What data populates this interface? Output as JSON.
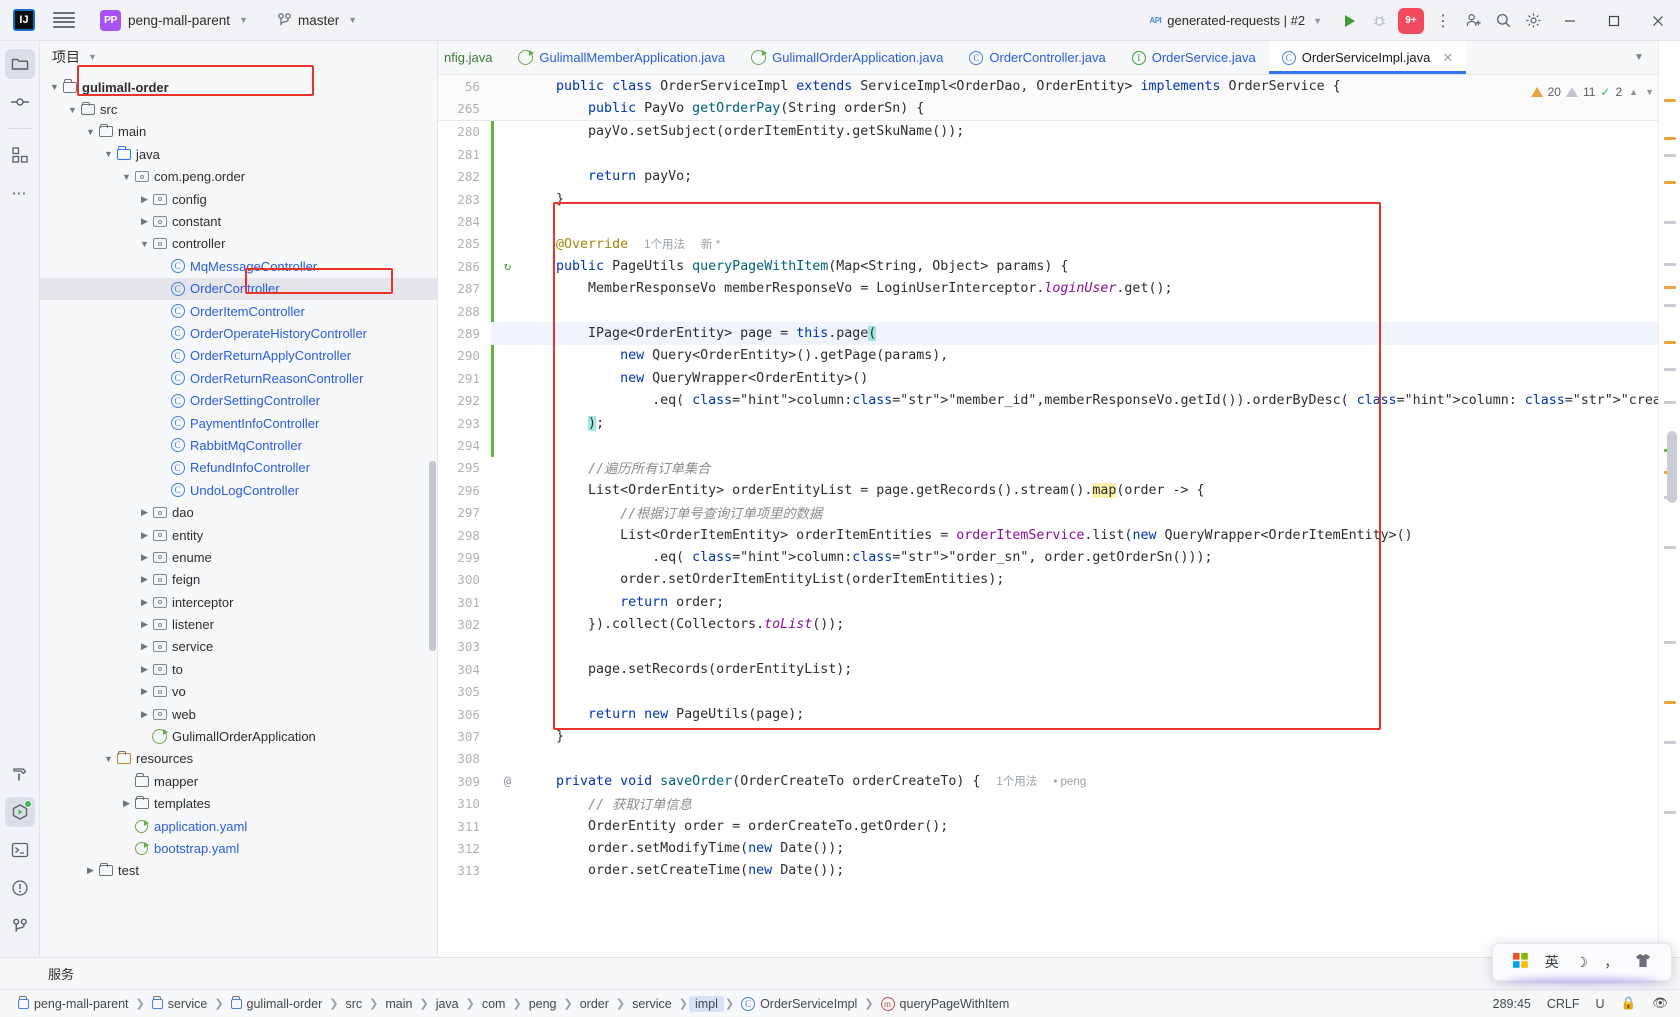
{
  "titlebar": {
    "logo": "IJ",
    "project": "peng-mall-parent",
    "branch": "master",
    "run_config": "generated-requests | #2",
    "notification_count": "9+",
    "minimize": "–",
    "maximize": "☐",
    "close": "✕",
    "more": "⋮"
  },
  "project_panel": {
    "title": "项目",
    "tree": [
      {
        "label": "gulimall-order",
        "depth": 1,
        "arrow": "v",
        "icon": "module-folder-icon",
        "bold": true,
        "boxed": true
      },
      {
        "label": "src",
        "depth": 2,
        "arrow": "v",
        "icon": "folder-icon"
      },
      {
        "label": "main",
        "depth": 3,
        "arrow": "v",
        "icon": "folder-icon"
      },
      {
        "label": "java",
        "depth": 4,
        "arrow": "v",
        "icon": "source-folder-icon"
      },
      {
        "label": "com.peng.order",
        "depth": 5,
        "arrow": "v",
        "icon": "package-icon"
      },
      {
        "label": "config",
        "depth": 6,
        "arrow": ">",
        "icon": "package-icon"
      },
      {
        "label": "constant",
        "depth": 6,
        "arrow": ">",
        "icon": "package-icon"
      },
      {
        "label": "controller",
        "depth": 6,
        "arrow": "v",
        "icon": "package-icon"
      },
      {
        "label": "MqMessageController",
        "depth": 7,
        "arrow": "",
        "icon": "class-icon",
        "cls": true
      },
      {
        "label": "OrderController",
        "depth": 7,
        "arrow": "",
        "icon": "class-icon",
        "cls": true,
        "selected": true,
        "boxed": true
      },
      {
        "label": "OrderItemController",
        "depth": 7,
        "arrow": "",
        "icon": "class-icon",
        "cls": true
      },
      {
        "label": "OrderOperateHistoryController",
        "depth": 7,
        "arrow": "",
        "icon": "class-icon",
        "cls": true
      },
      {
        "label": "OrderReturnApplyController",
        "depth": 7,
        "arrow": "",
        "icon": "class-icon",
        "cls": true
      },
      {
        "label": "OrderReturnReasonController",
        "depth": 7,
        "arrow": "",
        "icon": "class-icon",
        "cls": true
      },
      {
        "label": "OrderSettingController",
        "depth": 7,
        "arrow": "",
        "icon": "class-icon",
        "cls": true
      },
      {
        "label": "PaymentInfoController",
        "depth": 7,
        "arrow": "",
        "icon": "class-icon",
        "cls": true
      },
      {
        "label": "RabbitMqController",
        "depth": 7,
        "arrow": "",
        "icon": "class-icon",
        "cls": true
      },
      {
        "label": "RefundInfoController",
        "depth": 7,
        "arrow": "",
        "icon": "class-icon",
        "cls": true
      },
      {
        "label": "UndoLogController",
        "depth": 7,
        "arrow": "",
        "icon": "class-icon",
        "cls": true
      },
      {
        "label": "dao",
        "depth": 6,
        "arrow": ">",
        "icon": "package-icon"
      },
      {
        "label": "entity",
        "depth": 6,
        "arrow": ">",
        "icon": "package-icon"
      },
      {
        "label": "enume",
        "depth": 6,
        "arrow": ">",
        "icon": "package-icon"
      },
      {
        "label": "feign",
        "depth": 6,
        "arrow": ">",
        "icon": "package-icon"
      },
      {
        "label": "interceptor",
        "depth": 6,
        "arrow": ">",
        "icon": "package-icon"
      },
      {
        "label": "listener",
        "depth": 6,
        "arrow": ">",
        "icon": "package-icon"
      },
      {
        "label": "service",
        "depth": 6,
        "arrow": ">",
        "icon": "package-icon"
      },
      {
        "label": "to",
        "depth": 6,
        "arrow": ">",
        "icon": "package-icon"
      },
      {
        "label": "vo",
        "depth": 6,
        "arrow": ">",
        "icon": "package-icon"
      },
      {
        "label": "web",
        "depth": 6,
        "arrow": ">",
        "icon": "package-icon"
      },
      {
        "label": "GulimallOrderApplication",
        "depth": 6,
        "arrow": "",
        "icon": "spring-boot-icon"
      },
      {
        "label": "resources",
        "depth": 4,
        "arrow": "v",
        "icon": "resource-folder-icon"
      },
      {
        "label": "mapper",
        "depth": 5,
        "arrow": "",
        "icon": "folder-icon"
      },
      {
        "label": "templates",
        "depth": 5,
        "arrow": ">",
        "icon": "folder-icon"
      },
      {
        "label": "application.yaml",
        "depth": 5,
        "arrow": "",
        "icon": "yaml-icon",
        "yaml": true
      },
      {
        "label": "bootstrap.yaml",
        "depth": 5,
        "arrow": "",
        "icon": "yaml-icon",
        "yaml": true
      },
      {
        "label": "test",
        "depth": 3,
        "arrow": ">",
        "icon": "folder-icon"
      }
    ]
  },
  "editor": {
    "tabs": [
      {
        "label": "nfig.java",
        "icon": "class-icon",
        "clipped": true
      },
      {
        "label": "GulimallMemberApplication.java",
        "icon": "spring-boot-icon"
      },
      {
        "label": "GulimallOrderApplication.java",
        "icon": "spring-boot-icon"
      },
      {
        "label": "OrderController.java",
        "icon": "class-icon"
      },
      {
        "label": "OrderService.java",
        "icon": "interface-icon"
      },
      {
        "label": "OrderServiceImpl.java",
        "icon": "class-icon",
        "active": true,
        "closable": true
      }
    ],
    "inspection": {
      "warnings": "20",
      "weak_warnings": "11",
      "typos": "2"
    },
    "sticky_lines": [
      {
        "num": "56",
        "code": "public class OrderServiceImpl extends ServiceImpl<OrderDao, OrderEntity> implements OrderService {"
      },
      {
        "num": "265",
        "code": "public PayVo getOrderPay(String orderSn) {"
      }
    ],
    "lines": [
      {
        "num": "280",
        "text": "payVo.setSubject(orderItemEntity.getSkuName());"
      },
      {
        "num": "281",
        "text": ""
      },
      {
        "num": "282",
        "text": "return payVo;"
      },
      {
        "num": "283",
        "text": "}"
      },
      {
        "num": "284",
        "text": ""
      },
      {
        "num": "285",
        "text": "@Override  1个用法  新 *"
      },
      {
        "num": "286",
        "text": "public PageUtils queryPageWithItem(Map<String, Object> params) {",
        "gutter_icon": "override-method-icon"
      },
      {
        "num": "287",
        "text": "MemberResponseVo memberResponseVo = LoginUserInterceptor.loginUser.get();"
      },
      {
        "num": "288",
        "text": ""
      },
      {
        "num": "289",
        "text": "IPage<OrderEntity> page = this.page(",
        "current": true
      },
      {
        "num": "290",
        "text": "new Query<OrderEntity>().getPage(params),"
      },
      {
        "num": "291",
        "text": "new QueryWrapper<OrderEntity>()"
      },
      {
        "num": "292",
        "text": ".eq( column: \"member_id\",memberResponseVo.getId()).orderByDesc( column: \"create_time\")"
      },
      {
        "num": "293",
        "text": ");"
      },
      {
        "num": "294",
        "text": ""
      },
      {
        "num": "295",
        "text": "//遍历所有订单集合"
      },
      {
        "num": "296",
        "text": "List<OrderEntity> orderEntityList = page.getRecords().stream().map(order -> {"
      },
      {
        "num": "297",
        "text": "//根据订单号查询订单项里的数据"
      },
      {
        "num": "298",
        "text": "List<OrderItemEntity> orderItemEntities = orderItemService.list(new QueryWrapper<OrderItemEntity>()"
      },
      {
        "num": "299",
        "text": ".eq( column: \"order_sn\", order.getOrderSn()));"
      },
      {
        "num": "300",
        "text": "order.setOrderItemEntityList(orderItemEntities);"
      },
      {
        "num": "301",
        "text": "return order;"
      },
      {
        "num": "302",
        "text": "}).collect(Collectors.toList());"
      },
      {
        "num": "303",
        "text": ""
      },
      {
        "num": "304",
        "text": "page.setRecords(orderEntityList);"
      },
      {
        "num": "305",
        "text": ""
      },
      {
        "num": "306",
        "text": "return new PageUtils(page);"
      },
      {
        "num": "307",
        "text": "}"
      },
      {
        "num": "308",
        "text": ""
      },
      {
        "num": "309",
        "text": "private void saveOrder(OrderCreateTo orderCreateTo) {  1个用法  • peng",
        "gutter_icon": "annotation-icon"
      },
      {
        "num": "310",
        "text": "// 获取订单信息"
      },
      {
        "num": "311",
        "text": "OrderEntity order = orderCreateTo.getOrder();"
      },
      {
        "num": "312",
        "text": "order.setModifyTime(new Date());"
      },
      {
        "num": "313",
        "text": "order.setCreateTime(new Date());"
      }
    ]
  },
  "bottom": {
    "services_label": "服务",
    "breadcrumbs": [
      {
        "label": "peng-mall-parent",
        "icon": "module-icon"
      },
      {
        "label": "service",
        "icon": "module-icon"
      },
      {
        "label": "gulimall-order",
        "icon": "module-icon"
      },
      {
        "label": "src",
        "icon": ""
      },
      {
        "label": "main",
        "icon": ""
      },
      {
        "label": "java",
        "icon": ""
      },
      {
        "label": "com",
        "icon": ""
      },
      {
        "label": "peng",
        "icon": ""
      },
      {
        "label": "order",
        "icon": ""
      },
      {
        "label": "service",
        "icon": ""
      },
      {
        "label": "impl",
        "icon": "",
        "highlight": true
      },
      {
        "label": "OrderServiceImpl",
        "icon": "class-icon"
      },
      {
        "label": "queryPageWithItem",
        "icon": "method-icon"
      }
    ],
    "caret": "289:45",
    "line_separator": "CRLF",
    "encoding": "U"
  },
  "ime": {
    "windows_icon": "windows-icon",
    "mode": "英",
    "moon": "☽",
    "comma": "，",
    "shirt": "👕"
  },
  "colors": {
    "accent": "#3574f0",
    "annotation_red": "#e8342a",
    "keyword": "#0033b3",
    "string": "#067d17",
    "comment": "#8c8c8c",
    "method": "#00627a",
    "field": "#871094"
  }
}
